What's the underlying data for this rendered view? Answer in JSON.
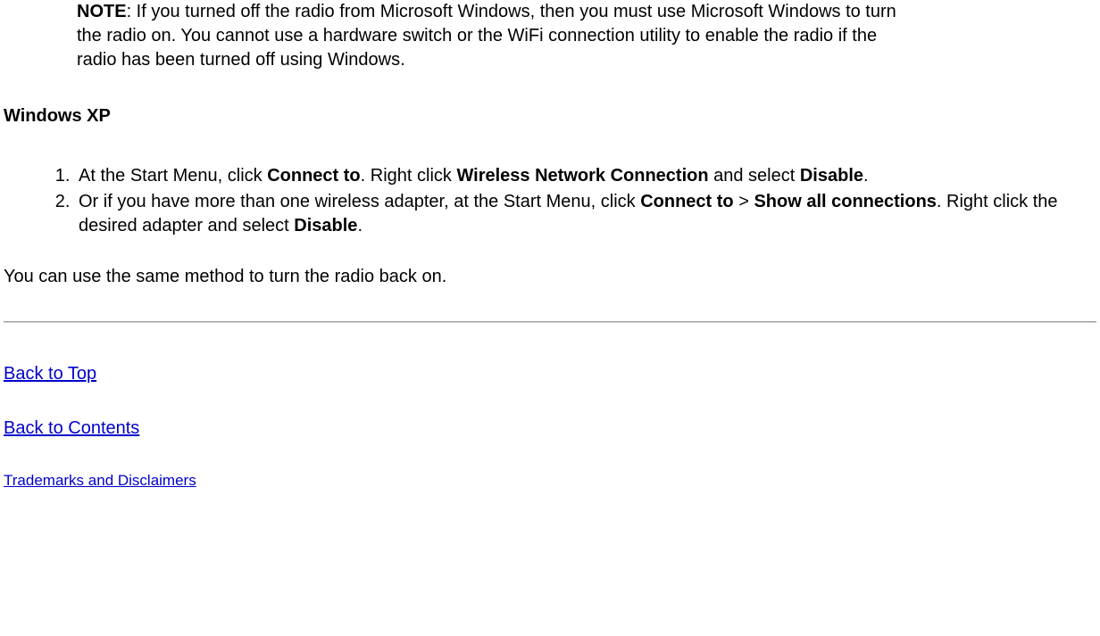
{
  "note": {
    "label": "NOTE",
    "text": ": If you turned off the radio from Microsoft Windows, then you must use Microsoft Windows to turn the radio on. You cannot use a hardware switch or the WiFi connection utility to enable the radio if the radio has been turned off using Windows."
  },
  "section_heading": "Windows XP",
  "steps": {
    "item1": {
      "t1": "At the Start Menu, click ",
      "b1": "Connect to",
      "t2": ". Right click ",
      "b2": "Wireless Network Connection",
      "t3": " and select ",
      "b3": "Disable",
      "t4": "."
    },
    "item2": {
      "t1": "Or if you have more than one wireless adapter, at the Start Menu, click ",
      "b1": "Connect to",
      "t2": " > ",
      "b2": "Show all connections",
      "t3": ". Right click the desired adapter and select ",
      "b3": "Disable",
      "t4": "."
    }
  },
  "closing_para": "You can use the same method to turn the radio back on.",
  "links": {
    "back_top": "Back to Top",
    "back_contents": "Back to Contents",
    "trademarks": "Trademarks and Disclaimers"
  }
}
